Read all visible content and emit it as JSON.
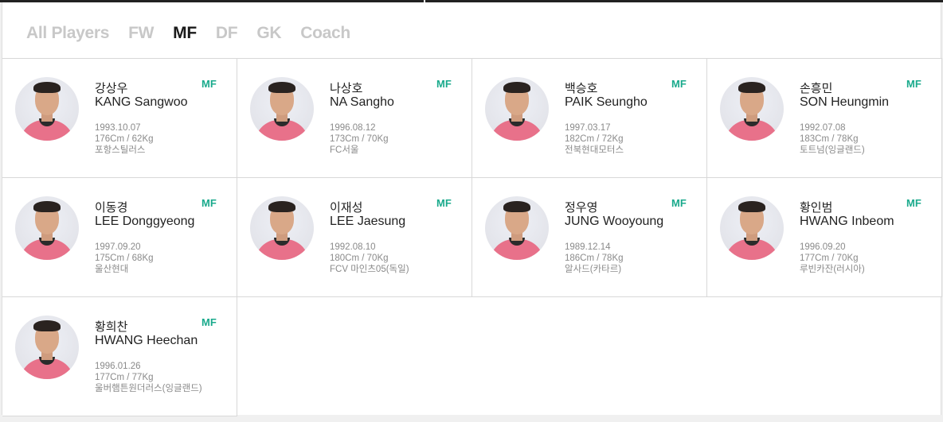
{
  "tabs": [
    {
      "label": "All Players",
      "active": false
    },
    {
      "label": "FW",
      "active": false
    },
    {
      "label": "MF",
      "active": true
    },
    {
      "label": "DF",
      "active": false
    },
    {
      "label": "GK",
      "active": false
    },
    {
      "label": "Coach",
      "active": false
    }
  ],
  "players": [
    {
      "kname": "강상우",
      "ename": "KANG Sangwoo",
      "position": "MF",
      "birth": "1993.10.07",
      "body": "176Cm / 62Kg",
      "club": "포항스틸러스"
    },
    {
      "kname": "나상호",
      "ename": "NA Sangho",
      "position": "MF",
      "birth": "1996.08.12",
      "body": "173Cm / 70Kg",
      "club": "FC서울"
    },
    {
      "kname": "백승호",
      "ename": "PAIK Seungho",
      "position": "MF",
      "birth": "1997.03.17",
      "body": "182Cm / 72Kg",
      "club": "전북현대모터스"
    },
    {
      "kname": "손흥민",
      "ename": "SON Heungmin",
      "position": "MF",
      "birth": "1992.07.08",
      "body": "183Cm / 78Kg",
      "club": "토트넘(잉글랜드)"
    },
    {
      "kname": "이동경",
      "ename": "LEE Donggyeong",
      "position": "MF",
      "birth": "1997.09.20",
      "body": "175Cm / 68Kg",
      "club": "울산현대"
    },
    {
      "kname": "이재성",
      "ename": "LEE Jaesung",
      "position": "MF",
      "birth": "1992.08.10",
      "body": "180Cm / 70Kg",
      "club": "FCV 마인츠05(독일)"
    },
    {
      "kname": "정우영",
      "ename": "JUNG Wooyoung",
      "position": "MF",
      "birth": "1989.12.14",
      "body": "186Cm / 78Kg",
      "club": "알사드(카타르)"
    },
    {
      "kname": "황인범",
      "ename": "HWANG Inbeom",
      "position": "MF",
      "birth": "1996.09.20",
      "body": "177Cm / 70Kg",
      "club": "루빈카잔(러시아)"
    },
    {
      "kname": "황희찬",
      "ename": "HWANG Heechan",
      "position": "MF",
      "birth": "1996.01.26",
      "body": "177Cm / 77Kg",
      "club": "울버햄튼원더러스(잉글랜드)"
    }
  ]
}
